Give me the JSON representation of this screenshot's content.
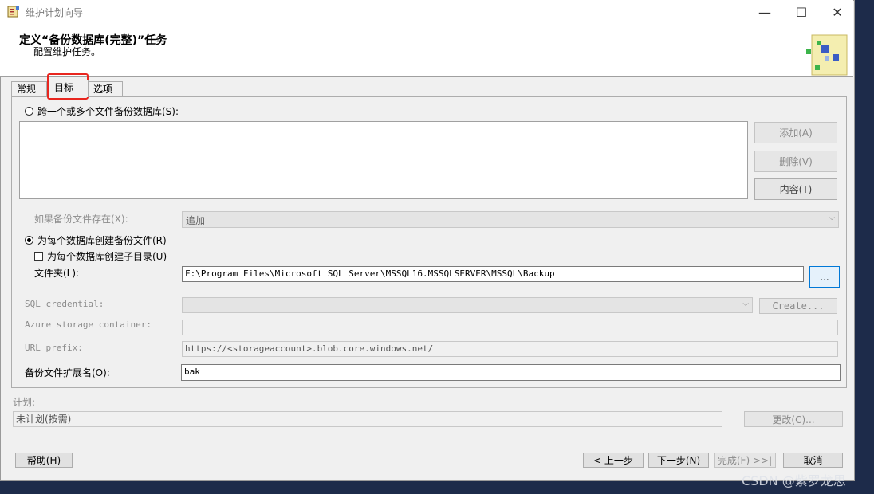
{
  "window": {
    "title": "维护计划向导",
    "minimize_glyph": "—",
    "maximize_glyph": "☐",
    "close_glyph": "✕"
  },
  "header": {
    "title": "定义“备份数据库(完整)”任务",
    "subtitle": "配置维护任务。"
  },
  "tabs": [
    {
      "label": "常规"
    },
    {
      "label": "目标"
    },
    {
      "label": "选项"
    }
  ],
  "destination": {
    "span_radio_label": "跨一个或多个文件备份数据库(S):",
    "add_label": "添加(A)",
    "remove_label": "删除(V)",
    "contents_label": "内容(T)",
    "if_exists_label": "如果备份文件存在(X):",
    "if_exists_value": "追加",
    "per_db_radio_label": "为每个数据库创建备份文件(R)",
    "subdir_checkbox_label": "为每个数据库创建子目录(U)",
    "folder_label": "文件夹(L):",
    "folder_value": "F:\\Program Files\\Microsoft SQL Server\\MSSQL16.MSSQLSERVER\\MSSQL\\Backup",
    "browse_label": "...",
    "sql_credential_label": "SQL credential:",
    "create_label": "Create...",
    "azure_container_label": "Azure storage container:",
    "url_prefix_label": "URL prefix:",
    "url_prefix_value": "https://<storageaccount>.blob.core.windows.net/",
    "extension_label": "备份文件扩展名(O):",
    "extension_value": "bak"
  },
  "schedule": {
    "label": "计划:",
    "value": "未计划(按需)",
    "change_label": "更改(C)..."
  },
  "footer": {
    "help_label": "帮助(H)",
    "back_label": "< 上一步",
    "next_label": "下一步(N)",
    "finish_label": "完成(F) >>|",
    "cancel_label": "取消"
  },
  "watermark": "CSDN @紫罗龙思",
  "colors": {
    "highlight": "#e8261f",
    "background": "#1d2b4a"
  }
}
